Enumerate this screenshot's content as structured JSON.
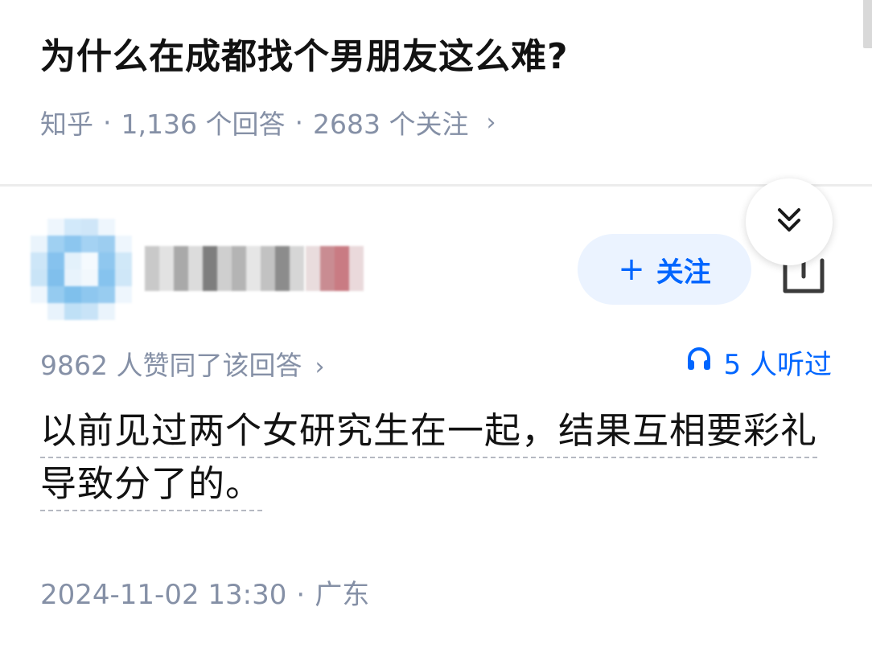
{
  "question": {
    "title": "为什么在成都找个男朋友这么难?",
    "source": "知乎",
    "answers_count": "1,136 个回答",
    "followers_count": "2683 个关注",
    "separator": "·",
    "chevron": "›"
  },
  "answer": {
    "author": {
      "name_visibility": "pixelated",
      "avatar_visibility": "pixelated"
    },
    "follow_label": "关注",
    "follow_icon": "plus-icon",
    "share_icon": "share-icon",
    "collapse_icon": "double-chevron-down-icon",
    "votes_text": "9862 人赞同了该回答",
    "votes_chevron": "›",
    "listen_icon": "headphones-icon",
    "listen_text": "5 人听过",
    "content": "以前见过两个女研究生在一起，结果互相要彩礼导致分了的。",
    "timestamp": "2024-11-02 13:30",
    "separator": "·",
    "location": "广东"
  },
  "colors": {
    "accent": "#0066ff",
    "follow_bg": "#ebf3ff",
    "meta_gray": "#8590a6",
    "text": "#121212"
  }
}
